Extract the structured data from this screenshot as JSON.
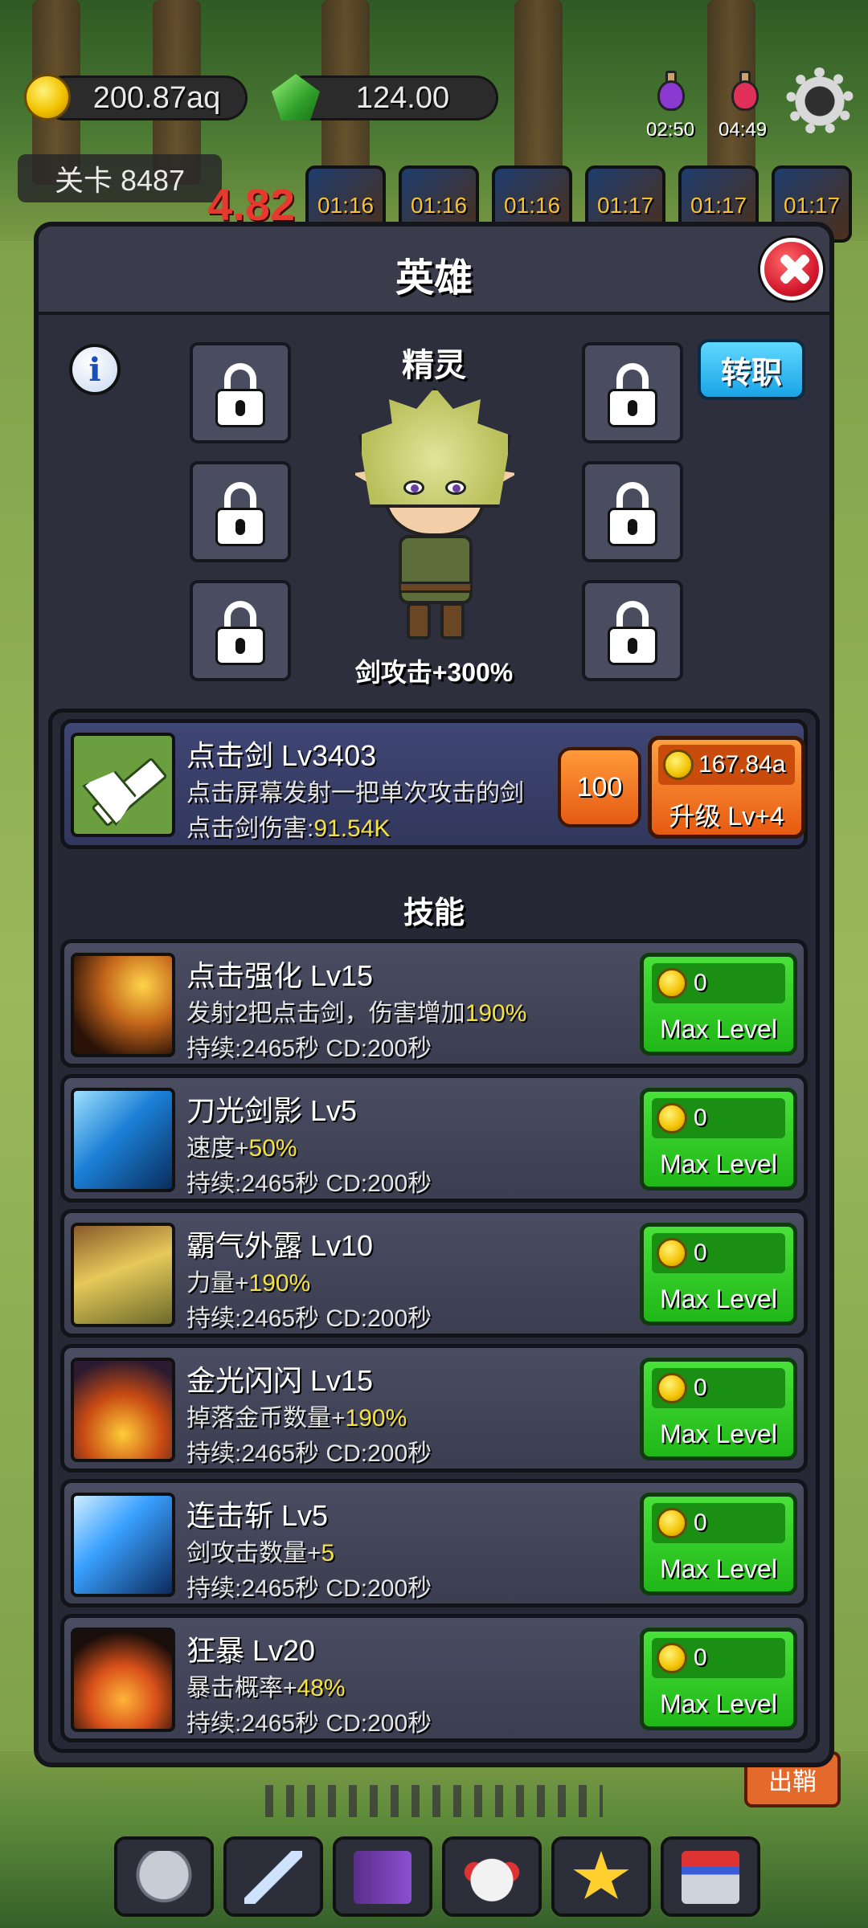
{
  "hud": {
    "gold": "200.87aq",
    "gems": "124.00",
    "potion_timers": [
      "02:50",
      "04:49"
    ],
    "stage": "关卡 8487",
    "buff_timers": [
      "01:16",
      "01:16",
      "01:16",
      "01:17",
      "01:17",
      "01:17"
    ],
    "damage_number": "4.82"
  },
  "panel": {
    "title": "英雄",
    "hero_class": "精灵",
    "job_change_label": "转职",
    "hero_bonus": "剑攻击+300%",
    "info_label": "i"
  },
  "main_skill": {
    "name": "点击剑 Lv3403",
    "desc": "点击屏幕发射一把单次攻击的剑",
    "damage_prefix": "点击剑伤害:",
    "damage_value": "91.54K",
    "level_step": "100",
    "upgrade_cost": "167.84a",
    "upgrade_label": "升级 Lv+4"
  },
  "skills_title": "技能",
  "skills": [
    {
      "name": "点击强化 Lv15",
      "desc_prefix": "发射2把点击剑，伤害增加",
      "desc_value": "190%",
      "duration": "持续:2465秒 CD:200秒",
      "cost": "0",
      "button_label": "Max Level"
    },
    {
      "name": "刀光剑影 Lv5",
      "desc_prefix": "速度+",
      "desc_value": "50%",
      "duration": "持续:2465秒 CD:200秒",
      "cost": "0",
      "button_label": "Max Level"
    },
    {
      "name": "霸气外露 Lv10",
      "desc_prefix": "力量+",
      "desc_value": "190%",
      "duration": "持续:2465秒 CD:200秒",
      "cost": "0",
      "button_label": "Max Level"
    },
    {
      "name": "金光闪闪 Lv15",
      "desc_prefix": "掉落金币数量+",
      "desc_value": "190%",
      "duration": "持续:2465秒 CD:200秒",
      "cost": "0",
      "button_label": "Max Level"
    },
    {
      "name": "连击斩 Lv5",
      "desc_prefix": "剑攻击数量+",
      "desc_value": "5",
      "duration": "持续:2465秒 CD:200秒",
      "cost": "0",
      "button_label": "Max Level"
    },
    {
      "name": "狂暴 Lv20",
      "desc_prefix": "暴击概率+",
      "desc_value": "48%",
      "duration": "持续:2465秒 CD:200秒",
      "cost": "0",
      "button_label": "Max Level"
    }
  ],
  "side_button": "出鞘",
  "colors": {
    "panel_bg": "#2d2f3d",
    "max_button": "#2fc41f",
    "upgrade_button": "#e8701c",
    "highlight": "#f5e23a"
  }
}
